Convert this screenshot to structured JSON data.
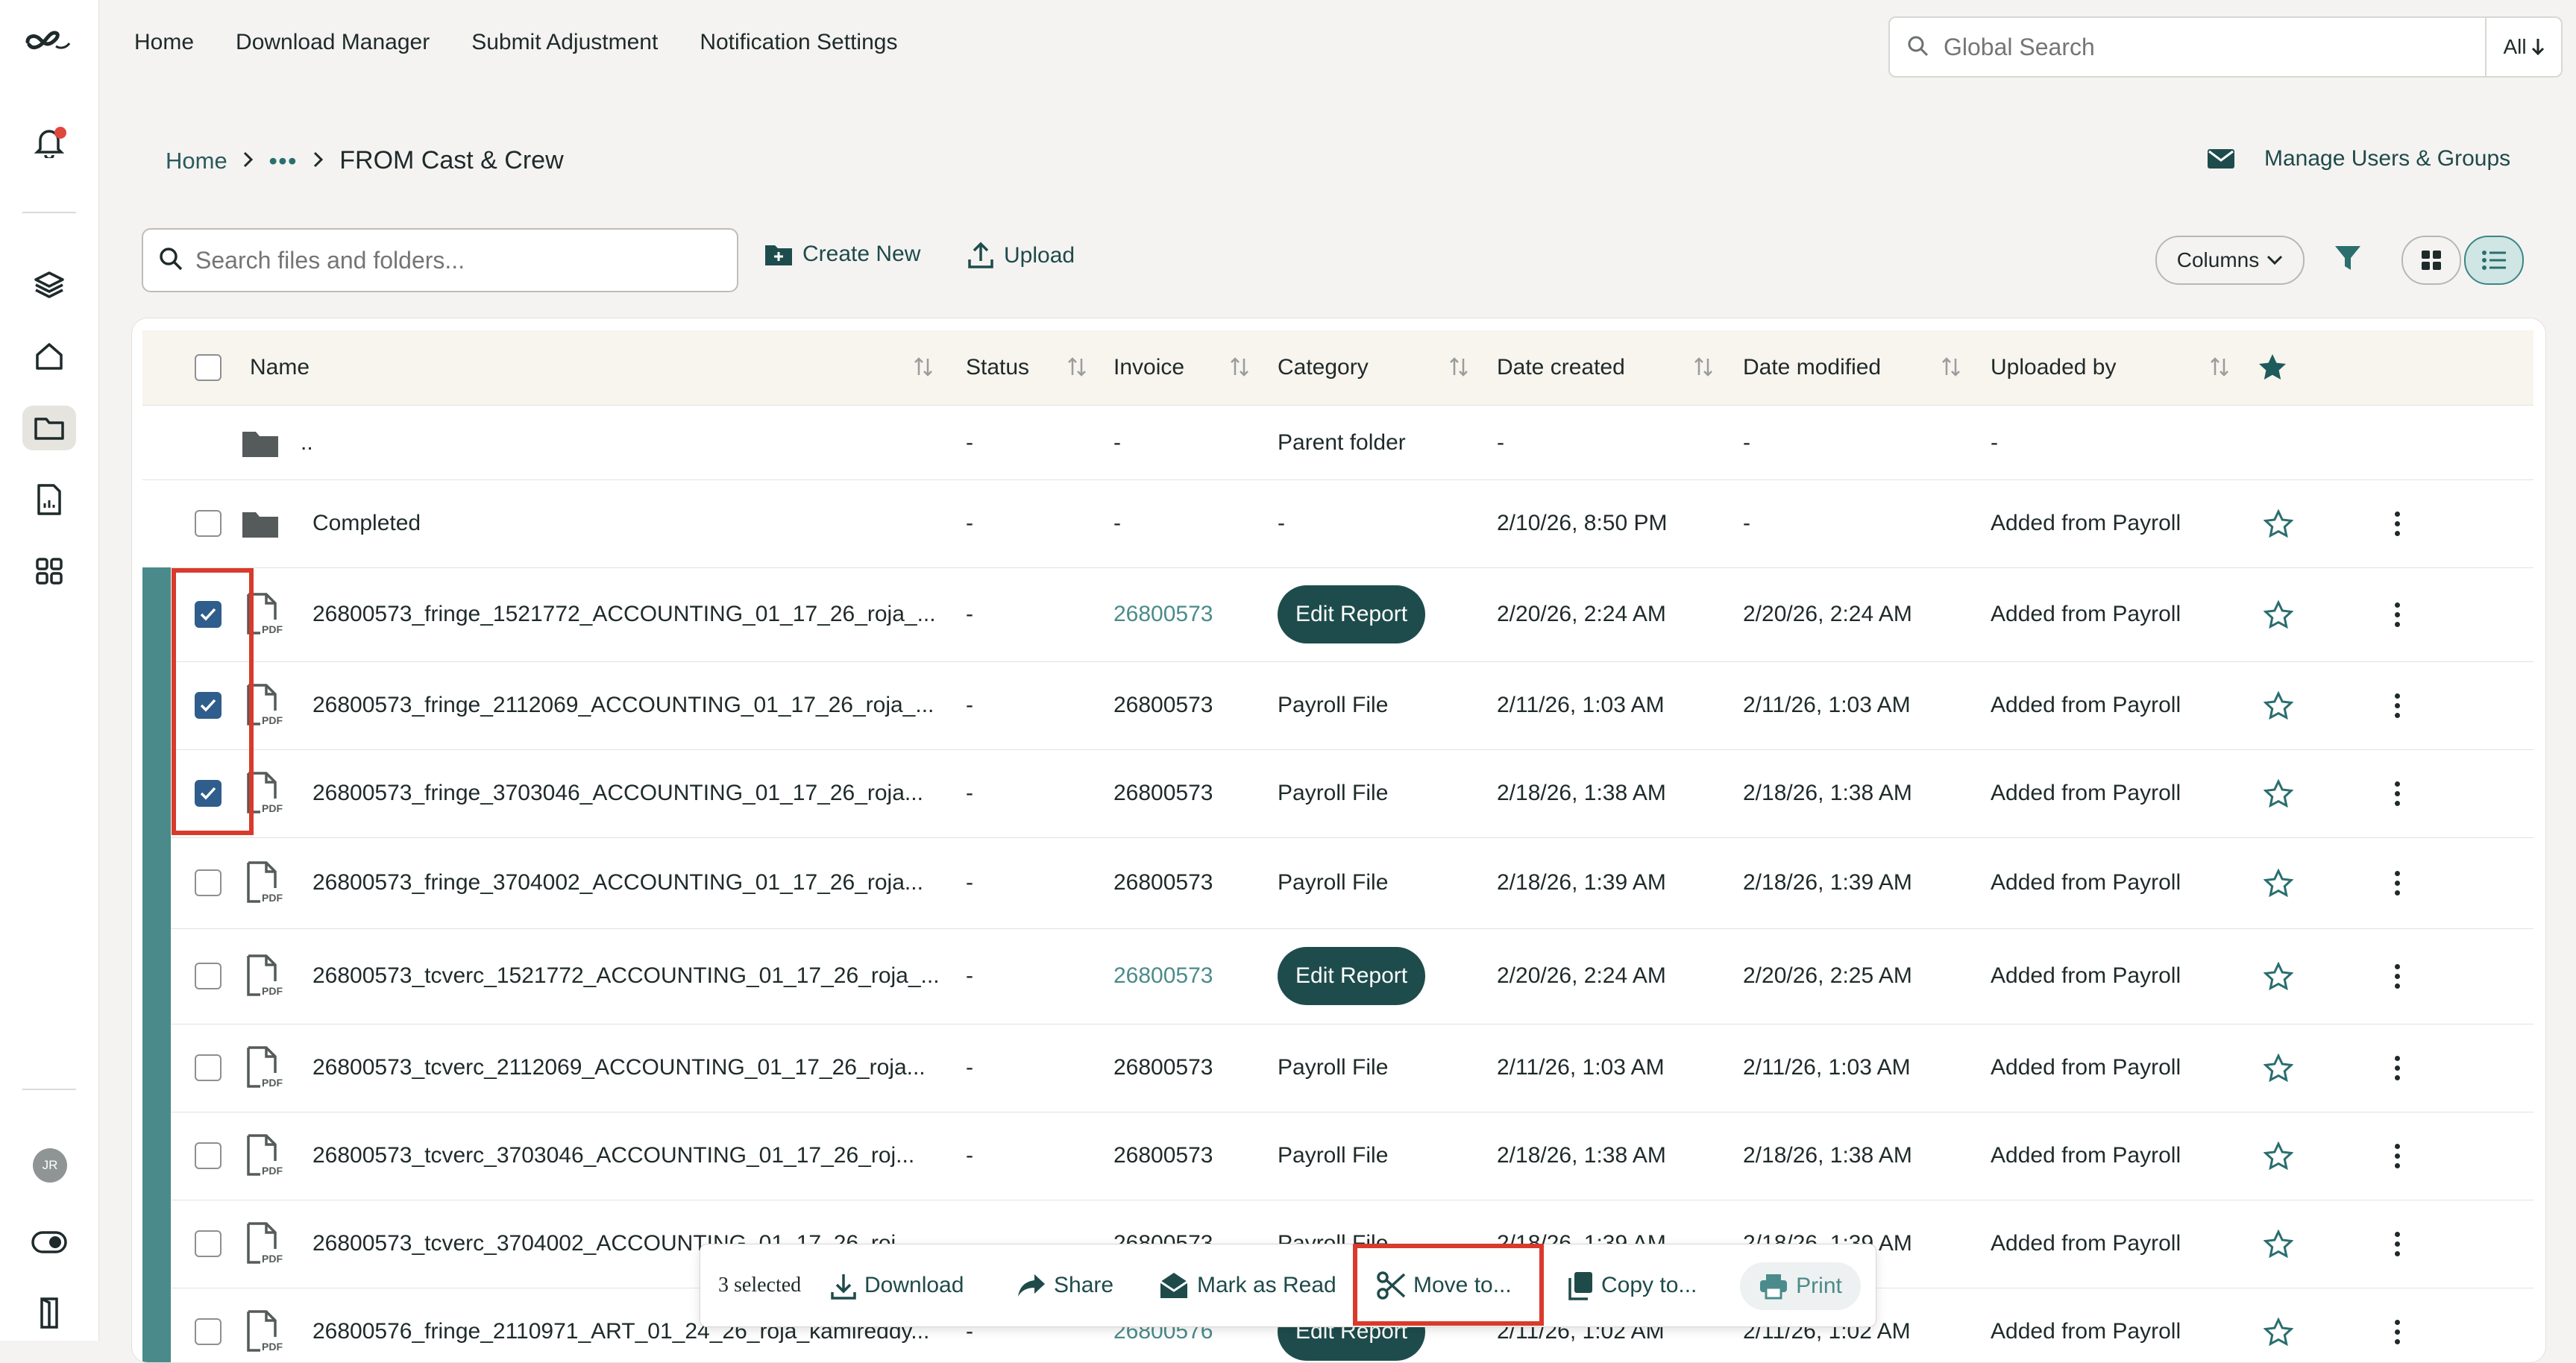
{
  "nav": [
    "Home",
    "Download Manager",
    "Submit Adjustment",
    "Notification Settings"
  ],
  "global_search": {
    "placeholder": "Global Search",
    "scope": "All"
  },
  "breadcrumb": {
    "home": "Home",
    "dots": "•••",
    "current": "FROM Cast & Crew"
  },
  "manage_label": "Manage Users & Groups",
  "toolbar": {
    "search_placeholder": "Search files and folders...",
    "create_new": "Create New",
    "upload": "Upload",
    "columns": "Columns"
  },
  "columns": [
    "Name",
    "Status",
    "Invoice",
    "Category",
    "Date created",
    "Date modified",
    "Uploaded by"
  ],
  "rows": [
    {
      "name": "..",
      "status": "-",
      "invoice": "-",
      "category": "Parent folder",
      "created": "-",
      "modified": "-",
      "uploaded_by": "-"
    },
    {
      "name": "Completed",
      "status": "-",
      "invoice": "-",
      "category": "-",
      "created": "2/10/26, 8:50 PM",
      "modified": "-",
      "uploaded_by": "Added from Payroll"
    },
    {
      "name": "26800573_fringe_1521772_ACCOUNTING_01_17_26_roja_...",
      "status": "-",
      "invoice": "26800573",
      "category": "Edit Report",
      "created": "2/20/26, 2:24 AM",
      "modified": "2/20/26, 2:24 AM",
      "uploaded_by": "Added from Payroll",
      "checked": true
    },
    {
      "name": "26800573_fringe_2112069_ACCOUNTING_01_17_26_roja_...",
      "status": "-",
      "invoice": "26800573",
      "category": "Payroll File",
      "created": "2/11/26, 1:03 AM",
      "modified": "2/11/26, 1:03 AM",
      "uploaded_by": "Added from Payroll",
      "checked": true
    },
    {
      "name": "26800573_fringe_3703046_ACCOUNTING_01_17_26_roja...",
      "status": "-",
      "invoice": "26800573",
      "category": "Payroll File",
      "created": "2/18/26, 1:38 AM",
      "modified": "2/18/26, 1:38 AM",
      "uploaded_by": "Added from Payroll",
      "checked": true
    },
    {
      "name": "26800573_fringe_3704002_ACCOUNTING_01_17_26_roja...",
      "status": "-",
      "invoice": "26800573",
      "category": "Payroll File",
      "created": "2/18/26, 1:39 AM",
      "modified": "2/18/26, 1:39 AM",
      "uploaded_by": "Added from Payroll"
    },
    {
      "name": "26800573_tcverc_1521772_ACCOUNTING_01_17_26_roja_...",
      "status": "-",
      "invoice": "26800573",
      "category": "Edit Report",
      "created": "2/20/26, 2:24 AM",
      "modified": "2/20/26, 2:25 AM",
      "uploaded_by": "Added from Payroll"
    },
    {
      "name": "26800573_tcverc_2112069_ACCOUNTING_01_17_26_roja...",
      "status": "-",
      "invoice": "26800573",
      "category": "Payroll File",
      "created": "2/11/26, 1:03 AM",
      "modified": "2/11/26, 1:03 AM",
      "uploaded_by": "Added from Payroll"
    },
    {
      "name": "26800573_tcverc_3703046_ACCOUNTING_01_17_26_roj...",
      "status": "-",
      "invoice": "26800573",
      "category": "Payroll File",
      "created": "2/18/26, 1:38 AM",
      "modified": "2/18/26, 1:38 AM",
      "uploaded_by": "Added from Payroll"
    },
    {
      "name": "26800573_tcverc_3704002_ACCOUNTING_01_17_26_roj...",
      "status": "-",
      "invoice": "26800573",
      "category": "Payroll File",
      "created": "2/18/26, 1:39 AM",
      "modified": "2/18/26, 1:39 AM",
      "uploaded_by": "Added from Payroll"
    },
    {
      "name": "26800576_fringe_2110971_ART_01_24_26_roja_kamireddy...",
      "status": "-",
      "invoice": "26800576",
      "category": "Edit Report",
      "created": "2/11/26, 1:02 AM",
      "modified": "2/11/26, 1:02 AM",
      "uploaded_by": "Added from Payroll"
    }
  ],
  "actionbar": {
    "selected": "3 selected",
    "download": "Download",
    "share": "Share",
    "mark_read": "Mark as Read",
    "move": "Move to...",
    "copy": "Copy to...",
    "print": "Print"
  },
  "avatar": "JR",
  "colors": {
    "accent": "#1e4c4c",
    "highlight": "#d93a2b",
    "row_bar": "#4a8a8a"
  }
}
